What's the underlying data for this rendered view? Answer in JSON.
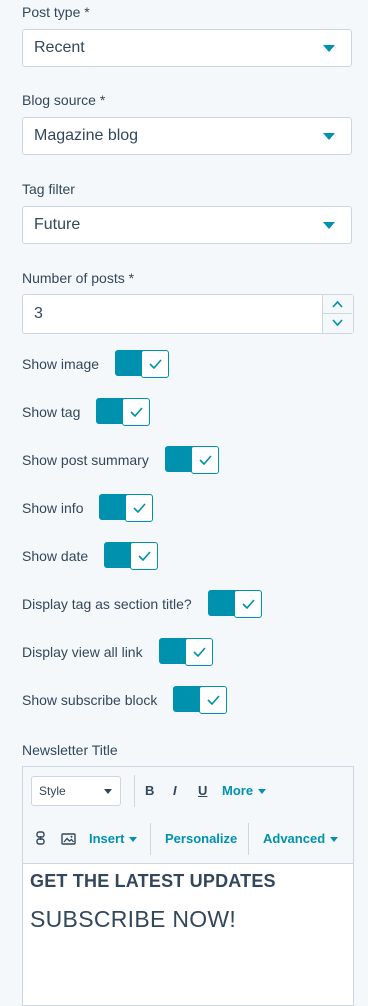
{
  "post_type": {
    "label": "Post type *",
    "value": "Recent"
  },
  "blog_source": {
    "label": "Blog source *",
    "value": "Magazine blog"
  },
  "tag_filter": {
    "label": "Tag filter",
    "value": "Future"
  },
  "number_of_posts": {
    "label": "Number of posts *",
    "value": "3"
  },
  "toggles": [
    {
      "label": "Show image",
      "checked": true
    },
    {
      "label": "Show tag",
      "checked": true
    },
    {
      "label": "Show post summary",
      "checked": true
    },
    {
      "label": "Show info",
      "checked": true
    },
    {
      "label": "Show date",
      "checked": true
    },
    {
      "label": "Display tag as section title?",
      "checked": true
    },
    {
      "label": "Display view all link",
      "checked": true
    },
    {
      "label": "Show subscribe block",
      "checked": true
    }
  ],
  "newsletter": {
    "label": "Newsletter Title",
    "toolbar": {
      "style_select": "Style",
      "bold": "B",
      "italic": "I",
      "underline": "U",
      "more": "More",
      "insert": "Insert",
      "personalize": "Personalize",
      "advanced": "Advanced"
    },
    "heading": "GET THE LATEST UPDATES",
    "subheading": "SUBSCRIBE NOW!"
  },
  "colors": {
    "accent": "#0091ae",
    "text": "#33475b",
    "border": "#cbd6e2",
    "background": "#f5f8fa"
  }
}
